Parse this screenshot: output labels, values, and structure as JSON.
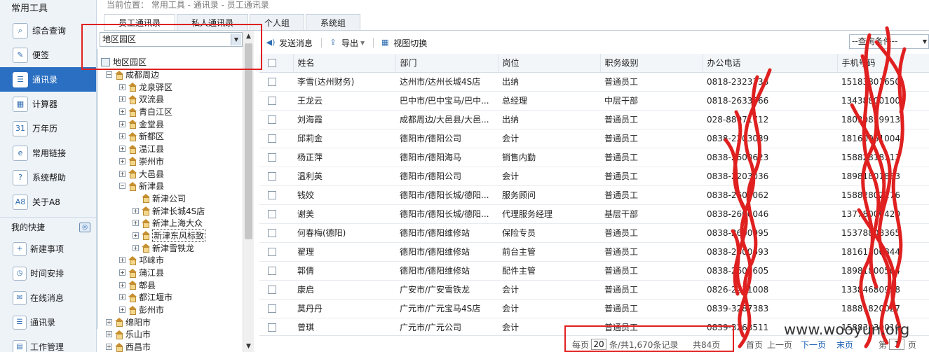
{
  "sidebar": {
    "section_title": "常用工具",
    "items": [
      {
        "label": "综合查询",
        "icon": "search-icon",
        "glyph": "⌕",
        "active": false
      },
      {
        "label": "便签",
        "icon": "note-icon",
        "glyph": "✎",
        "active": false
      },
      {
        "label": "通讯录",
        "icon": "contacts-icon",
        "glyph": "☰",
        "active": true
      },
      {
        "label": "计算器",
        "icon": "calculator-icon",
        "glyph": "▦",
        "active": false
      },
      {
        "label": "万年历",
        "icon": "calendar-icon",
        "glyph": "31",
        "active": false
      },
      {
        "label": "常用链接",
        "icon": "link-icon",
        "glyph": "e",
        "active": false
      },
      {
        "label": "系统帮助",
        "icon": "help-icon",
        "glyph": "?",
        "active": false
      },
      {
        "label": "关于A8",
        "icon": "about-icon",
        "glyph": "A8",
        "active": false
      }
    ],
    "quick_title": "我的快捷",
    "quick_items": [
      {
        "label": "新建事项",
        "icon": "new-item-icon",
        "glyph": "+"
      },
      {
        "label": "时间安排",
        "icon": "schedule-icon",
        "glyph": "◷"
      },
      {
        "label": "在线消息",
        "icon": "message-icon",
        "glyph": "✉"
      },
      {
        "label": "通讯录",
        "icon": "contacts-icon",
        "glyph": "☰"
      },
      {
        "label": "工作管理",
        "icon": "work-icon",
        "glyph": "▤"
      }
    ]
  },
  "breadcrumb": "当前位置： 常用工具 - 通讯录 - 员工通讯录",
  "tabs": [
    "员工通讯录",
    "私人通讯录",
    "个人组",
    "系统组"
  ],
  "active_tab": 0,
  "tree": {
    "select_value": "地区园区",
    "root_label": "地区园区",
    "nodes": [
      {
        "label": "成都周边",
        "level": 1,
        "exp": "−"
      },
      {
        "label": "龙泉驿区",
        "level": 2,
        "exp": "+"
      },
      {
        "label": "双流县",
        "level": 2,
        "exp": "+"
      },
      {
        "label": "青白江区",
        "level": 2,
        "exp": "+"
      },
      {
        "label": "金堂县",
        "level": 2,
        "exp": "+"
      },
      {
        "label": "新都区",
        "level": 2,
        "exp": "+"
      },
      {
        "label": "温江县",
        "level": 2,
        "exp": "+"
      },
      {
        "label": "崇州市",
        "level": 2,
        "exp": "+"
      },
      {
        "label": "大邑县",
        "level": 2,
        "exp": "+"
      },
      {
        "label": "新津县",
        "level": 2,
        "exp": "−"
      },
      {
        "label": "新津公司",
        "level": 3,
        "exp": ""
      },
      {
        "label": "新津长城4S店",
        "level": 3,
        "exp": "+"
      },
      {
        "label": "新津上海大众",
        "level": 3,
        "exp": "+"
      },
      {
        "label": "新津东风标致",
        "level": 3,
        "exp": "+",
        "selected": true
      },
      {
        "label": "新津雪铁龙",
        "level": 3,
        "exp": "+"
      },
      {
        "label": "邛崃市",
        "level": 2,
        "exp": "+"
      },
      {
        "label": "蒲江县",
        "level": 2,
        "exp": "+"
      },
      {
        "label": "郫县",
        "level": 2,
        "exp": "+"
      },
      {
        "label": "都江堰市",
        "level": 2,
        "exp": "+"
      },
      {
        "label": "彭州市",
        "level": 2,
        "exp": "+"
      },
      {
        "label": "绵阳市",
        "level": 1,
        "exp": "+"
      },
      {
        "label": "乐山市",
        "level": 1,
        "exp": "+"
      },
      {
        "label": "西昌市",
        "level": 1,
        "exp": "+"
      }
    ]
  },
  "toolbar": {
    "send_message": "发送消息",
    "export": "导出",
    "view_switch": "视图切换",
    "query_select": "--查询条件--"
  },
  "grid": {
    "columns": [
      "姓名",
      "部门",
      "岗位",
      "职务级别",
      "办公电话",
      "手机号码"
    ],
    "rows": [
      [
        "李雪(达州财务)",
        "达州市/达州长城4S店",
        "出纳",
        "普通员工",
        "0818-2323338",
        "15183801650"
      ],
      [
        "王龙云",
        "巴中市/巴中宝马/巴中...",
        "总经理",
        "中层干部",
        "0818-2633566",
        "13438800100"
      ],
      [
        "刘海霞",
        "成都周边/大邑县/大邑...",
        "出纳",
        "普通员工",
        "028-88071712",
        "18030899913"
      ],
      [
        "邱莉金",
        "德阳市/德阳公司",
        "会计",
        "普通员工",
        "0838-2203039",
        "18160061004"
      ],
      [
        "杨正萍",
        "德阳市/德阳海马",
        "销售内勤",
        "普通员工",
        "0838-2600623",
        "15882818313"
      ],
      [
        "温利英",
        "德阳市/德阳公司",
        "会计",
        "普通员工",
        "0838-2203036",
        "18981801883"
      ],
      [
        "钱姣",
        "德阳市/德阳长城/德阳...",
        "服务顾问",
        "普通员工",
        "0838-2600062",
        "15882802276"
      ],
      [
        "谢美",
        "德阳市/德阳长城/德阳...",
        "代理服务经理",
        "基层干部",
        "0838-2600046",
        "13778000420"
      ],
      [
        "何春梅(德阳)",
        "德阳市/德阳维修站",
        "保险专员",
        "普通员工",
        "0838-2600095",
        "15378808365"
      ],
      [
        "翟理",
        "德阳市/德阳维修站",
        "前台主管",
        "普通员工",
        "0838-2600693",
        "18161300844"
      ],
      [
        "郭倩",
        "德阳市/德阳维修站",
        "配件主管",
        "普通员工",
        "0838-2600605",
        "18981800504"
      ],
      [
        "康启",
        "广安市/广安雪铁龙",
        "会计",
        "普通员工",
        "0826-2271008",
        "13384680958"
      ],
      [
        "莫丹丹",
        "广元市/广元宝马4S店",
        "会计",
        "普通员工",
        "0839-3287383",
        "18881820027"
      ],
      [
        "曾琪",
        "广元市/广元公司",
        "会计",
        "普通员工",
        "0839-3263511",
        "15883830010"
      ]
    ]
  },
  "pager": {
    "per_page_label": "每页",
    "per_page_value": "20",
    "total_text": "条/共1,670条记录",
    "pages_text": "共84页",
    "first": "首页",
    "prev": "上一页",
    "next": "下一页",
    "last": "末页",
    "goto_prefix": "第",
    "page_value": "1",
    "goto_suffix": "页"
  },
  "watermark": "www.wooyun.org",
  "colors": {
    "accent": "#2a6fc1",
    "annotation_red": "#e02020"
  }
}
